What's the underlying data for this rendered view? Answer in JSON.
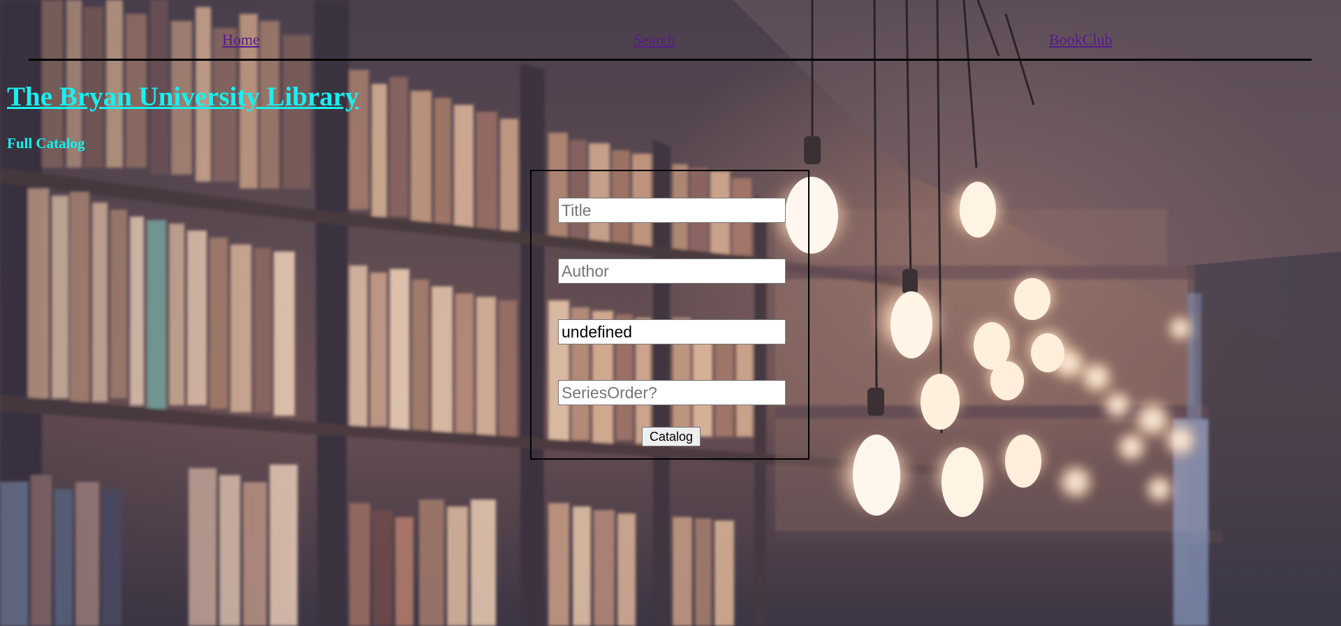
{
  "nav": {
    "links": [
      {
        "label": "Home"
      },
      {
        "label": "Search"
      },
      {
        "label": "BookClub"
      }
    ]
  },
  "header": {
    "title": "The Bryan University Library",
    "subtitle": "Full Catalog"
  },
  "form": {
    "title_placeholder": "Title",
    "title_value": "",
    "author_placeholder": "Author",
    "author_value": "",
    "series_value": "undefined",
    "series_order_placeholder": "SeriesOrder?",
    "series_order_value": "",
    "submit_label": "Catalog"
  },
  "colors": {
    "heading": "#18f0f0",
    "link_visited": "#551a8b",
    "rule": "#000000"
  }
}
